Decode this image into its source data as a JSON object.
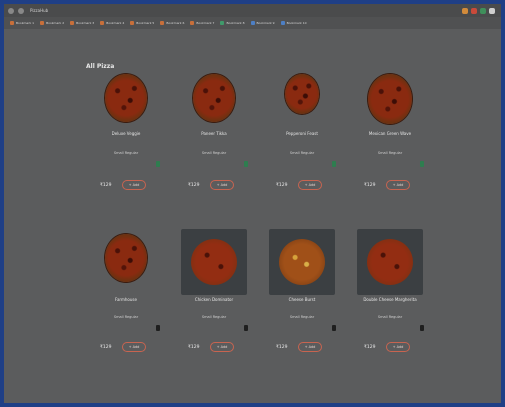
{
  "browser": {
    "tab_title": "PizzaHub",
    "window_control_colors": [
      "#d28b3b",
      "#c94a3a",
      "#3f8f5b",
      "#cfcfcf"
    ]
  },
  "bookmarks": [
    {
      "label": "Bookmark 1",
      "icon": "bookmark-orange"
    },
    {
      "label": "Bookmark 2",
      "icon": "bookmark-orange"
    },
    {
      "label": "Bookmark 3",
      "icon": "bookmark-orange"
    },
    {
      "label": "Bookmark 4",
      "icon": "bookmark-orange"
    },
    {
      "label": "Bookmark 5",
      "icon": "bookmark-orange"
    },
    {
      "label": "Bookmark 6",
      "icon": "bookmark-orange"
    },
    {
      "label": "Bookmark 7",
      "icon": "bookmark-orange"
    },
    {
      "label": "Bookmark 8",
      "icon": "bookmark-green"
    },
    {
      "label": "Bookmark 9",
      "icon": "bookmark-blue"
    },
    {
      "label": "Bookmark 10",
      "icon": "bookmark-blue"
    }
  ],
  "page": {
    "section_title": "All Pizza"
  },
  "items": [
    {
      "name": "Deluxe Veggie",
      "size": "Small",
      "crust": "Regular",
      "price": "₹129",
      "add_label": "+ Add",
      "image": "pizza-round"
    },
    {
      "name": "Paneer Tikka",
      "size": "Small",
      "crust": "Regular",
      "price": "₹129",
      "add_label": "+ Add",
      "image": "pizza-round"
    },
    {
      "name": "Pepperoni Feast",
      "size": "Small",
      "crust": "Regular",
      "price": "₹129",
      "add_label": "+ Add",
      "image": "pizza-round"
    },
    {
      "name": "Mexican Green Wave",
      "size": "Small",
      "crust": "Regular",
      "price": "₹129",
      "add_label": "+ Add",
      "image": "pizza-round"
    },
    {
      "name": "Farmhouse",
      "size": "Small",
      "crust": "Regular",
      "price": "₹129",
      "add_label": "+ Add",
      "image": "pizza-round"
    },
    {
      "name": "Chicken Dominator",
      "size": "Small",
      "crust": "Regular",
      "price": "₹129",
      "add_label": "+ Add",
      "image": "pizza-photo"
    },
    {
      "name": "Cheese Burst",
      "size": "Small",
      "crust": "Regular",
      "price": "₹129",
      "add_label": "+ Add",
      "image": "pizza-photo-cheese"
    },
    {
      "name": "Double Cheese Margherita",
      "size": "Small",
      "crust": "Regular",
      "price": "₹129",
      "add_label": "+ Add",
      "image": "pizza-photo"
    }
  ],
  "colors": {
    "outer_border": "#1f3f86",
    "background": "#5b5c5d",
    "button_border": "#c86450",
    "veg_marker": "#2e7d4f"
  }
}
